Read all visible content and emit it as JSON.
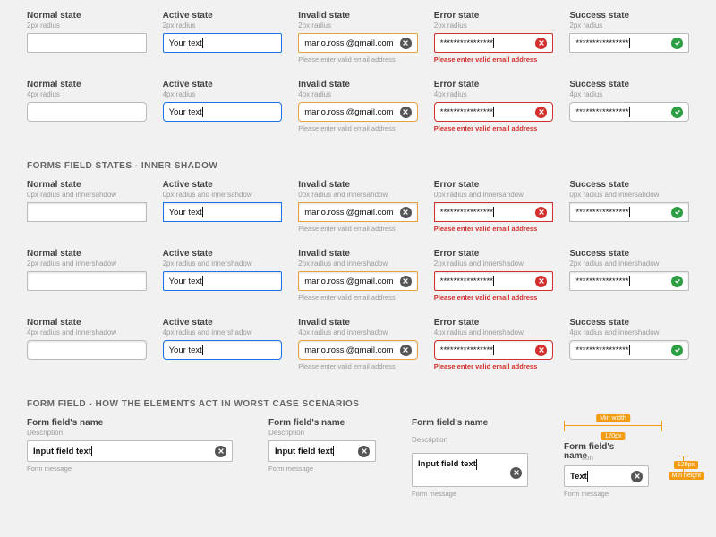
{
  "labels": {
    "normal": "Normal state",
    "active": "Active state",
    "invalid": "Invalid state",
    "error": "Error state",
    "success": "Success state"
  },
  "sublabels": {
    "r2": "2px radius",
    "r4": "4px radius",
    "r0_ish": "0px radius and innersahdow",
    "r2_ish": "2px radius and innershadow",
    "r4_ish": "4px radius and innershadow"
  },
  "values": {
    "your_text": "Your text",
    "email": "mario.rossi@gmail.com",
    "masked": "****************"
  },
  "messages": {
    "invalid": "Please enter valid email address",
    "error": "Please enter valid email address"
  },
  "section_inner_shadow": "FORMS FIELD STATES - INNER SHADOW",
  "section_worst_case": "FORM FIELD - HOW THE ELEMENTS ACT IN WORST CASE SCENARIOS",
  "worst_case": {
    "title": "Form field's name",
    "title_wrapped": "Form field's name",
    "desc": "Description",
    "value": "Input field text",
    "value_short": "Text",
    "msg": "Form message"
  },
  "dims": {
    "min_width_label": "Min width",
    "min_width_value": "120px",
    "pill_label": "120px",
    "min_height_label": "Min height"
  }
}
